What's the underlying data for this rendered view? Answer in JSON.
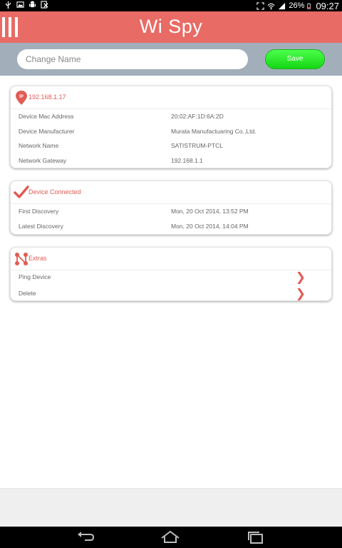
{
  "status_bar": {
    "left_icons": [
      "usb-icon",
      "image-icon",
      "android-debug-icon",
      "excel-icon"
    ],
    "right_icons": [
      "screenshot-icon",
      "wifi-icon",
      "signal-icon"
    ],
    "battery_percent": "26%",
    "time": "09:27"
  },
  "app": {
    "title": "Wi Spy"
  },
  "name_bar": {
    "placeholder": "Change Name",
    "value": "",
    "save_label": "Save"
  },
  "colors": {
    "header": "#e86b65",
    "namebar": "#a3aebb",
    "accent_red": "#e05c55",
    "save_green": "#22e022"
  },
  "cards": {
    "network": {
      "icon": "ip-pin-icon",
      "title": "192.168.1.17",
      "rows": [
        {
          "label": "Device Mac Address",
          "value": "20:02:AF:1D:6A:2D"
        },
        {
          "label": "Device Manufacturer",
          "value": "Murata Manufactuaring Co.,Ltd."
        },
        {
          "label": "Network Name",
          "value": "SATISTRUM-PTCL"
        },
        {
          "label": "Network Gateway",
          "value": "192.168.1.1"
        }
      ]
    },
    "connection": {
      "icon": "checkmark-icon",
      "title": "Device Connected",
      "rows": [
        {
          "label": "First Discovery",
          "value": "Mon, 20 Oct 2014, 13:52 PM"
        },
        {
          "label": "Latest Discovery",
          "value": "Mon, 20 Oct 2014, 14:04 PM"
        }
      ]
    },
    "extras": {
      "icon": "network-nodes-icon",
      "title": "Extras",
      "items": [
        {
          "label": "Ping Device"
        },
        {
          "label": "Delete"
        }
      ]
    }
  },
  "nav_bar": {
    "buttons": [
      "back-icon",
      "home-icon",
      "recent-apps-icon"
    ]
  }
}
